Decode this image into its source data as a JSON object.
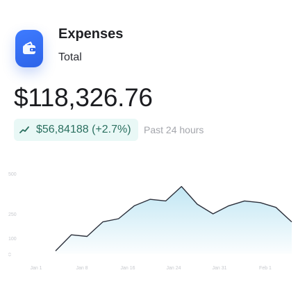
{
  "header": {
    "title": "Expenses",
    "subtitle": "Total",
    "icon": "wallet-icon",
    "icon_color": "#3a74ff"
  },
  "summary": {
    "amount": "$118,326.76",
    "change": "$56,84188 (+2.7%)",
    "period": "Past 24 hours",
    "trend_icon": "trend-up-icon",
    "change_color": "#2a6f5f",
    "badge_bg": "#e9f8f6"
  },
  "chart_data": {
    "type": "area",
    "x": [
      "Jan 1",
      "Jan 8",
      "Jan 16",
      "Jan 24",
      "Jan 31",
      "Feb 1"
    ],
    "y_ticks": [
      0,
      100,
      250,
      500
    ],
    "ylim": [
      0,
      500
    ],
    "series": [
      {
        "values": [
          20,
          120,
          110,
          200,
          220,
          300,
          340,
          330,
          420,
          310,
          250,
          300,
          330,
          320,
          290,
          200
        ],
        "color": "#8fd2ea"
      }
    ],
    "grid": false
  }
}
